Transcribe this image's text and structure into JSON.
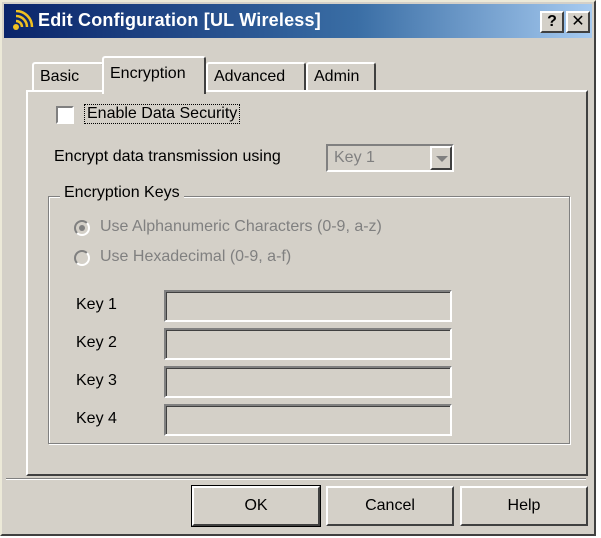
{
  "window": {
    "title": "Edit Configuration [UL Wireless]",
    "help_button": "?",
    "close_button": "✕"
  },
  "tabs": [
    {
      "label": "Basic",
      "active": false
    },
    {
      "label": "Encryption",
      "active": true
    },
    {
      "label": "Advanced",
      "active": false
    },
    {
      "label": "Admin",
      "active": false
    }
  ],
  "encryption": {
    "enable_security": {
      "label": "Enable Data Security",
      "checked": false
    },
    "encrypt_using": {
      "label": "Encrypt data transmission using",
      "selected": "Key 1",
      "enabled": false
    },
    "group_label": "Encryption Keys",
    "radio_alnum": {
      "label": "Use Alphanumeric Characters (0-9, a-z)",
      "selected": true,
      "enabled": false
    },
    "radio_hex": {
      "label": "Use Hexadecimal (0-9, a-f)",
      "selected": false,
      "enabled": false
    },
    "keys": [
      {
        "label": "Key 1",
        "value": ""
      },
      {
        "label": "Key 2",
        "value": ""
      },
      {
        "label": "Key 3",
        "value": ""
      },
      {
        "label": "Key 4",
        "value": ""
      }
    ]
  },
  "buttons": {
    "ok": "OK",
    "cancel": "Cancel",
    "help": "Help"
  }
}
